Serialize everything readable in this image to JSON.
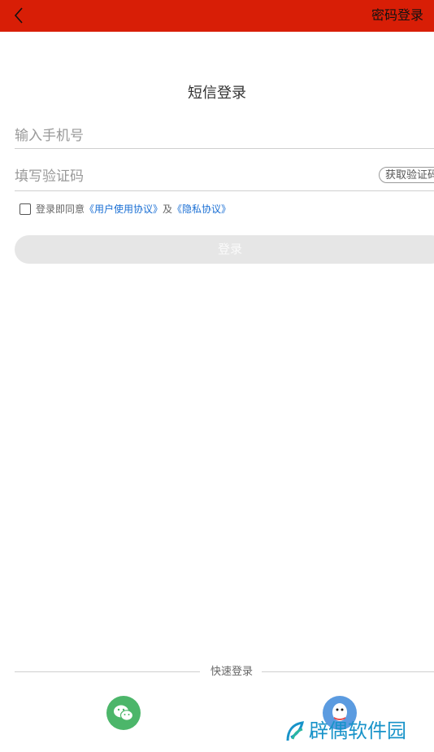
{
  "header": {
    "back_icon": "chevron-left-icon",
    "right_action": "密码登录"
  },
  "title": "短信登录",
  "phone": {
    "value": "",
    "placeholder": "输入手机号"
  },
  "code": {
    "value": "",
    "placeholder": "填写验证码",
    "button_label": "获取验证码"
  },
  "agreement": {
    "prefix": "登录即同意",
    "user_agreement": "《用户使用协议》",
    "conjunction": "及",
    "privacy_policy": "《隐私协议》",
    "checked": false
  },
  "login_button": "登录",
  "quick_login": {
    "label": "快速登录",
    "options": [
      "wechat-icon",
      "qq-icon"
    ]
  },
  "watermark": "辟偶软件园",
  "colors": {
    "header_bg": "#d81e06",
    "link": "#1a6fd4",
    "wechat": "#4cb66a",
    "qq": "#5b9be0",
    "watermark": "#1893c9"
  }
}
